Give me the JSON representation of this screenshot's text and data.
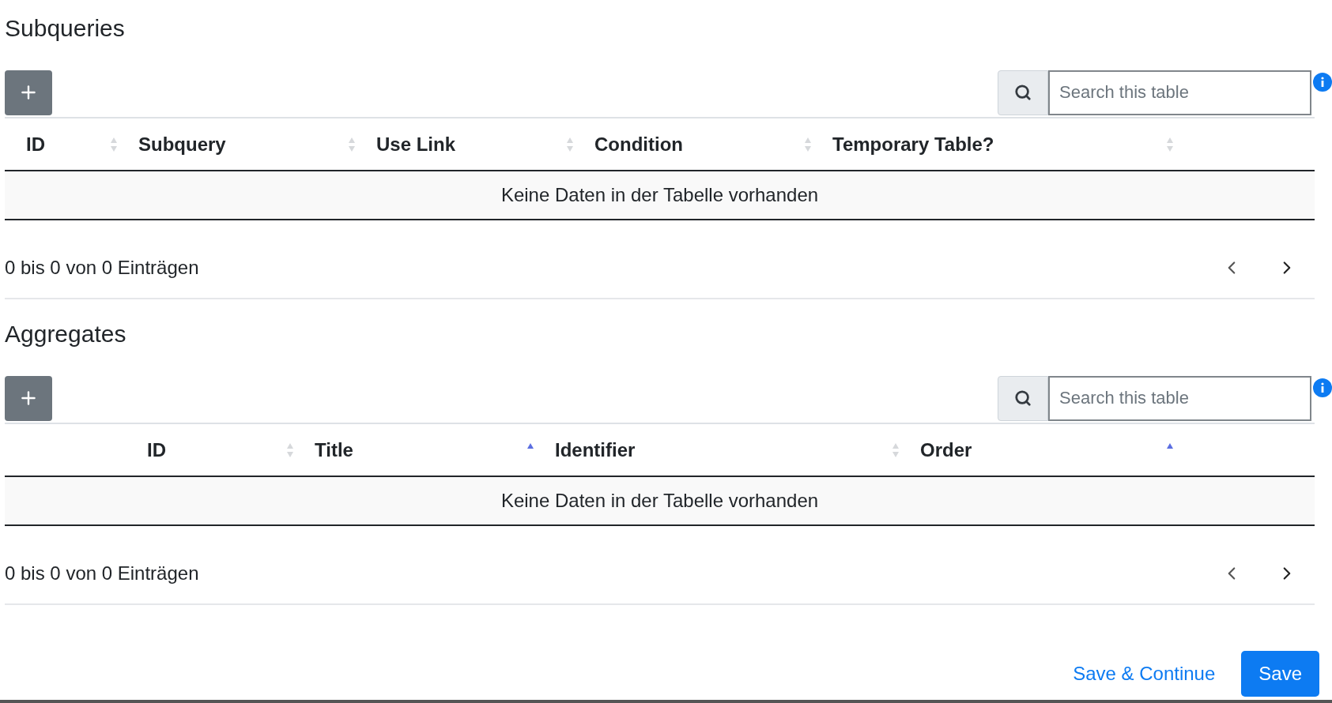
{
  "sections": [
    {
      "title": "Subqueries",
      "search": {
        "placeholder": "Search this table"
      },
      "columns": [
        {
          "label": "ID",
          "sorted_ascending": false
        },
        {
          "label": "Subquery",
          "sorted_ascending": false
        },
        {
          "label": "Use Link",
          "sorted_ascending": false
        },
        {
          "label": "Condition",
          "sorted_ascending": false
        },
        {
          "label": "Temporary Table?",
          "sorted_ascending": false
        }
      ],
      "empty_message": "Keine Daten in der Tabelle vorhanden",
      "info": "0 bis 0 von 0 Einträgen"
    },
    {
      "title": "Aggregates",
      "search": {
        "placeholder": "Search this table"
      },
      "columns": [
        {
          "label": "ID",
          "sorted_ascending": false
        },
        {
          "label": "Title",
          "sorted_ascending": true
        },
        {
          "label": "Identifier",
          "sorted_ascending": false
        },
        {
          "label": "Order",
          "sorted_ascending": true
        }
      ],
      "empty_message": "Keine Daten in der Tabelle vorhanden",
      "info": "0 bis 0 von 0 Einträgen"
    }
  ],
  "actions": [
    {
      "label": "Save & Continue",
      "kind": "link"
    },
    {
      "label": "Save",
      "kind": "primary"
    }
  ]
}
